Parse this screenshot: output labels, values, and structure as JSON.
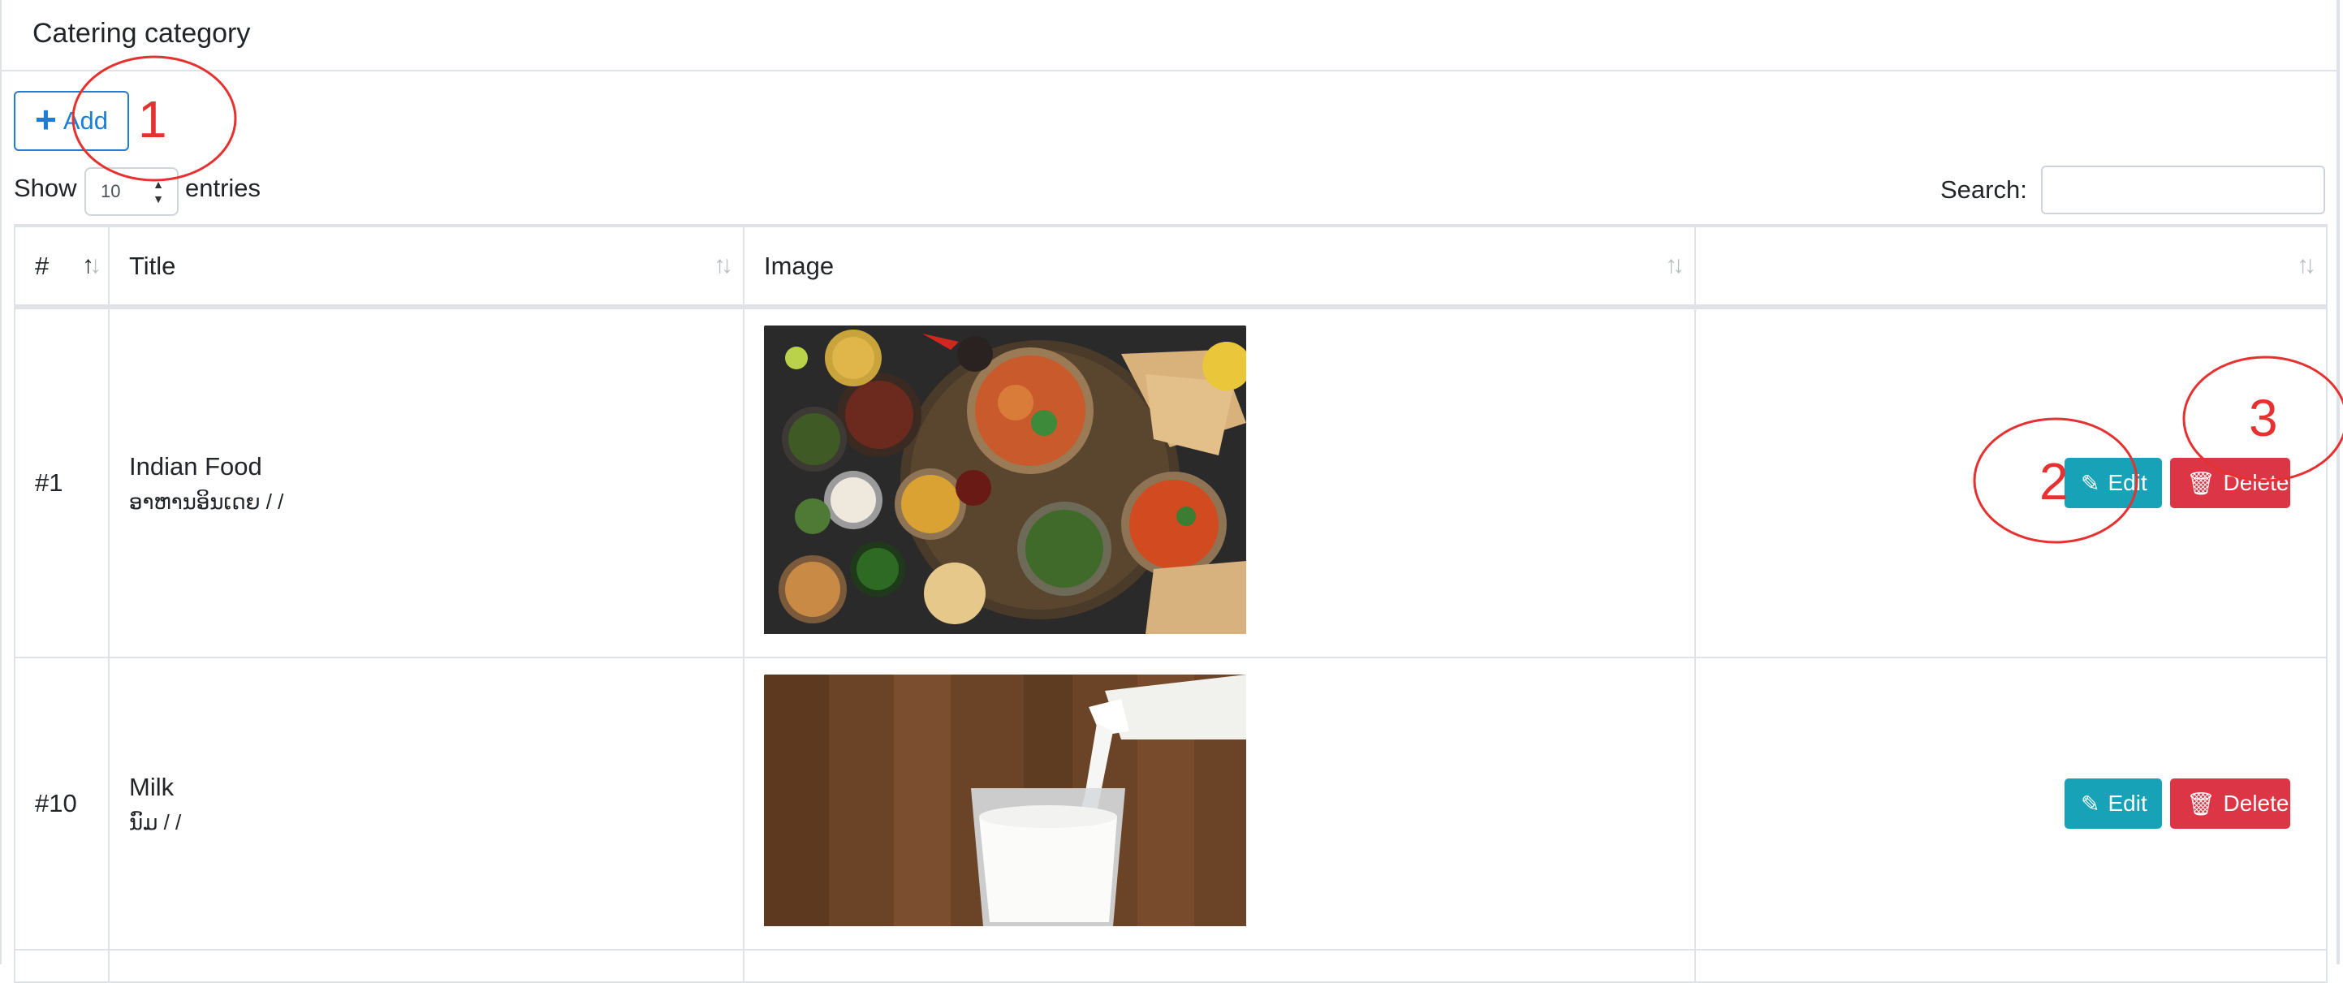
{
  "card": {
    "title": "Catering category"
  },
  "toolbar": {
    "add_label": "Add"
  },
  "length": {
    "show": "Show",
    "value": "10",
    "entries": "entries"
  },
  "search": {
    "label": "Search:",
    "value": ""
  },
  "table": {
    "columns": [
      "#",
      "Title",
      "Image",
      ""
    ],
    "rows": [
      {
        "id": "#1",
        "title": "Indian Food",
        "subtitle": "ອາຫານອິນເດຍ / /",
        "image": "indian-food-thali",
        "edit": "Edit",
        "delete": "Delete"
      },
      {
        "id": "#10",
        "title": "Milk",
        "subtitle": "ນົມ / /",
        "image": "milk-glass",
        "edit": "Edit",
        "delete": "Delete"
      }
    ]
  },
  "annotations": {
    "one": "1",
    "two": "2",
    "three": "3"
  },
  "colors": {
    "primary": "#1c7ed6",
    "info": "#17a2b8",
    "danger": "#dc3545",
    "annotation": "#e5312f"
  }
}
